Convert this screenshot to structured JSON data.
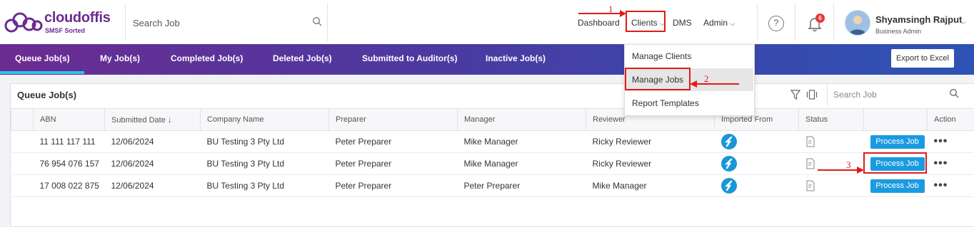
{
  "header": {
    "logo_text": "cloudoffis",
    "logo_tagline": "SMSF Sorted",
    "search_placeholder": "Search Job",
    "nav": {
      "dashboard": "Dashboard",
      "clients": "Clients",
      "dms": "DMS",
      "admin": "Admin"
    },
    "help_glyph": "?",
    "notification_count": "6",
    "user_name": "Shyamsingh Rajput",
    "user_role": "Business Admin"
  },
  "tabs": [
    "Queue Job(s)",
    "My Job(s)",
    "Completed Job(s)",
    "Deleted Job(s)",
    "Submitted to Auditor(s)",
    "Inactive Job(s)"
  ],
  "export_label": "Export to Excel",
  "clients_menu": [
    "Manage Clients",
    "Manage Jobs",
    "Report Templates"
  ],
  "panel": {
    "title": "Queue Job(s)",
    "search_placeholder": "Search Job"
  },
  "table": {
    "columns": [
      "ABN",
      "Submitted Date",
      "Company Name",
      "Preparer",
      "Manager",
      "Reviewer",
      "Imported From",
      "Status",
      "",
      "Action"
    ],
    "rows": [
      {
        "abn": "11 111 117 111",
        "date": "12/06/2024",
        "company": "BU Testing 3 Pty Ltd",
        "preparer": "Peter Preparer",
        "manager": "Mike Manager",
        "reviewer": "Ricky Reviewer",
        "action_label": "Process Job"
      },
      {
        "abn": "76 954 076 157",
        "date": "12/06/2024",
        "company": "BU Testing 3 Pty Ltd",
        "preparer": "Peter Preparer",
        "manager": "Mike Manager",
        "reviewer": "Ricky Reviewer",
        "action_label": "Process Job"
      },
      {
        "abn": "17 008 022 875",
        "date": "12/06/2024",
        "company": "BU Testing 3 Pty Ltd",
        "preparer": "Peter Preparer",
        "manager": "Peter Preparer",
        "reviewer": "Mike Manager",
        "action_label": "Process Job"
      }
    ]
  },
  "more_glyph": "•••",
  "annotations": [
    "1",
    "2",
    "3"
  ],
  "colors": {
    "brand_purple": "#6b2c91",
    "tab_gradient_start": "#6b2c91",
    "tab_gradient_end": "#2d53b5",
    "active_tab_underline": "#2ec4ef",
    "process_button": "#1a9be0",
    "annotation_red": "#e01b1b"
  },
  "icons": [
    "cloud-logo-icon",
    "search-icon",
    "chevron-down-icon",
    "help-icon",
    "bell-icon",
    "filter-icon",
    "columns-icon",
    "sort-down-arrow-icon",
    "imported-source-icon",
    "status-document-icon",
    "more-icon"
  ]
}
